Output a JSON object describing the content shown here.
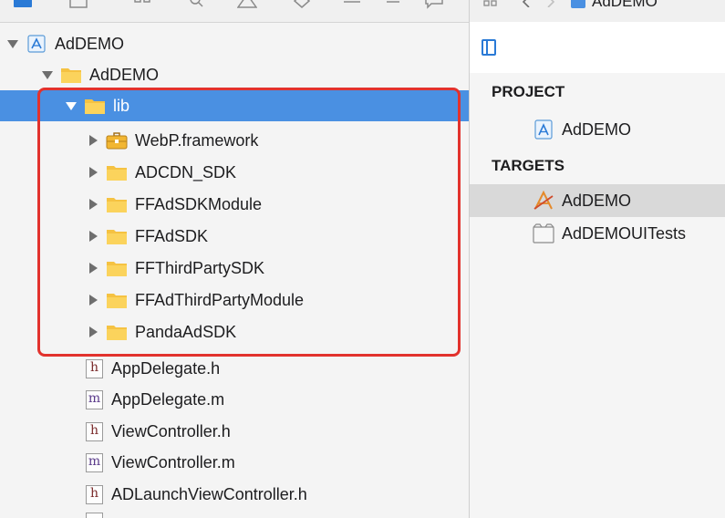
{
  "navigator": {
    "tree": [
      {
        "label": "AdDEMO",
        "kind": "project",
        "expanded": true
      },
      {
        "label": "AdDEMO",
        "kind": "folder",
        "expanded": true
      },
      {
        "label": "lib",
        "kind": "folder",
        "expanded": true,
        "selected": true
      },
      {
        "label": "WebP.framework",
        "kind": "framework",
        "expanded": false
      },
      {
        "label": "ADCDN_SDK",
        "kind": "folder",
        "expanded": false
      },
      {
        "label": "FFAdSDKModule",
        "kind": "folder",
        "expanded": false
      },
      {
        "label": "FFAdSDK",
        "kind": "folder",
        "expanded": false
      },
      {
        "label": "FFThirdPartySDK",
        "kind": "folder",
        "expanded": false
      },
      {
        "label": "FFAdThirdPartyModule",
        "kind": "folder",
        "expanded": false
      },
      {
        "label": "PandaAdSDK",
        "kind": "folder",
        "expanded": false
      },
      {
        "label": "AppDelegate.h",
        "kind": "header-file",
        "badge": "h"
      },
      {
        "label": "AppDelegate.m",
        "kind": "implementation-file",
        "badge": "m"
      },
      {
        "label": "ViewController.h",
        "kind": "header-file",
        "badge": "h"
      },
      {
        "label": "ViewController.m",
        "kind": "implementation-file",
        "badge": "m"
      },
      {
        "label": "ADLaunchViewController.h",
        "kind": "header-file",
        "badge": "h"
      }
    ],
    "highlight_color": "#e2322d",
    "selection_color": "#4a90e2"
  },
  "editor": {
    "breadcrumb_project": "AdDEMO",
    "sections": {
      "project_header": "PROJECT",
      "targets_header": "TARGETS"
    },
    "project_item": "AdDEMO",
    "targets": [
      {
        "label": "AdDEMO",
        "icon": "app-target-icon",
        "selected": true
      },
      {
        "label": "AdDEMOUITests",
        "icon": "test-bundle-icon",
        "selected": false
      }
    ]
  }
}
